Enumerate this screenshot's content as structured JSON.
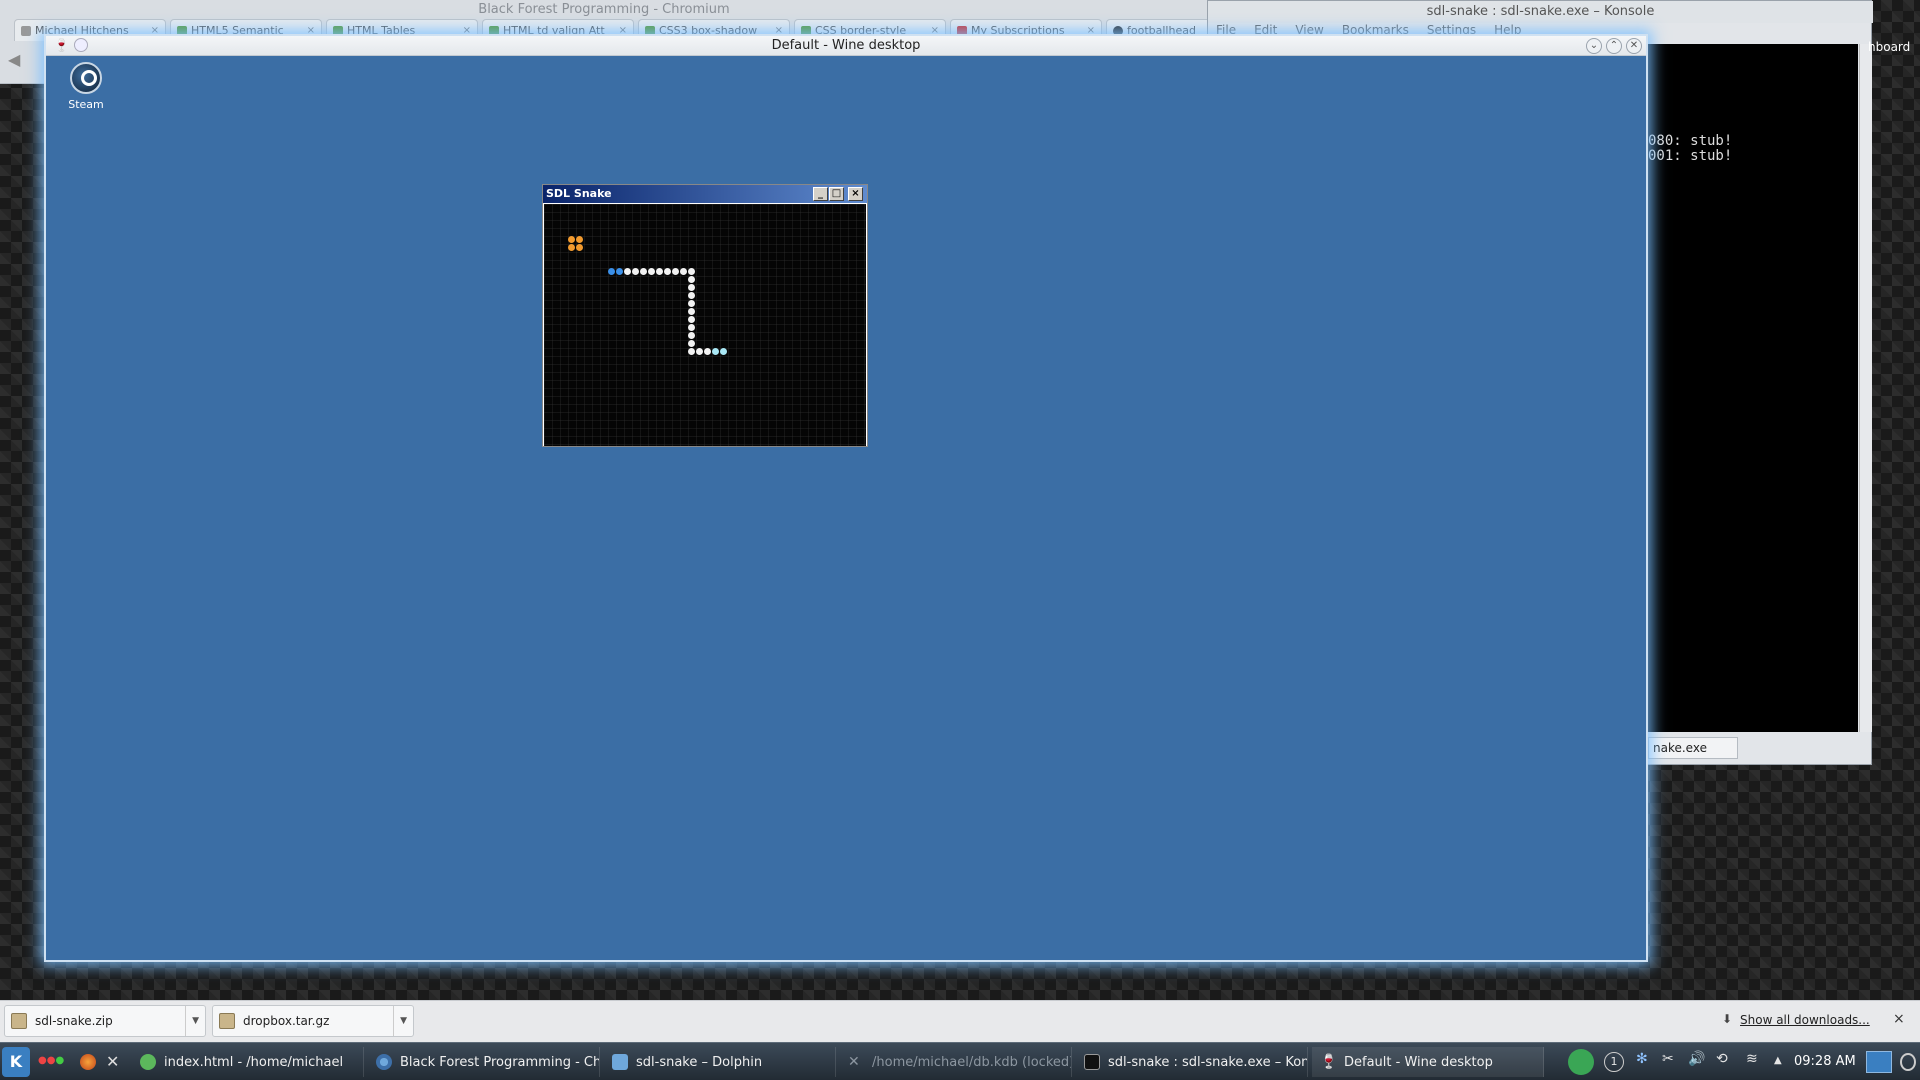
{
  "chromium": {
    "title": "Black Forest Programming - Chromium",
    "tabs": [
      "Michael Hitchens",
      "HTML5 Semantic",
      "HTML Tables",
      "HTML td valign Att",
      "CSS3 box-shadow",
      "CSS border-style",
      "My Subscriptions",
      "footballhead"
    ]
  },
  "konsole": {
    "title": "sdl-snake : sdl-snake.exe – Konsole",
    "menu": [
      "File",
      "Edit",
      "View",
      "Bookmarks",
      "Settings",
      "Help"
    ],
    "terminal_lines": [
      "080: stub!",
      "001: stub!"
    ],
    "tab_label": "nake.exe",
    "side_text": "hboard"
  },
  "wine": {
    "title": "Default - Wine desktop",
    "desktop_icon": "Steam"
  },
  "snake": {
    "title": "SDL Snake",
    "colors": {
      "food": "#f29a2e",
      "head": "#3a8fe8",
      "body": "#f2f2f2",
      "tail": "#a9e8f5",
      "board": "#050505"
    },
    "cols": 32,
    "rows": 25,
    "food": [
      [
        3,
        4
      ],
      [
        4,
        4
      ],
      [
        3,
        5
      ],
      [
        4,
        5
      ]
    ],
    "head": [
      [
        8,
        8
      ],
      [
        9,
        8
      ]
    ],
    "body": [
      [
        10,
        8
      ],
      [
        11,
        8
      ],
      [
        12,
        8
      ],
      [
        13,
        8
      ],
      [
        14,
        8
      ],
      [
        15,
        8
      ],
      [
        16,
        8
      ],
      [
        17,
        8
      ],
      [
        18,
        8
      ],
      [
        18,
        9
      ],
      [
        18,
        10
      ],
      [
        18,
        11
      ],
      [
        18,
        12
      ],
      [
        18,
        13
      ],
      [
        18,
        14
      ],
      [
        18,
        15
      ],
      [
        18,
        16
      ],
      [
        18,
        17
      ],
      [
        18,
        18
      ],
      [
        19,
        18
      ],
      [
        20,
        18
      ]
    ],
    "tail": [
      [
        21,
        18
      ],
      [
        22,
        18
      ]
    ]
  },
  "downloads": {
    "items": [
      "sdl-snake.zip",
      "dropbox.tar.gz"
    ],
    "show_all": "Show all downloads...",
    "close": "×"
  },
  "taskbar": {
    "tasks": [
      {
        "label": "index.html - /home/michael",
        "state": "normal"
      },
      {
        "label": "Black Forest Programming - Chrom",
        "state": "normal"
      },
      {
        "label": "sdl-snake – Dolphin",
        "state": "normal"
      },
      {
        "label": "/home/michael/db.kdb (locked) –",
        "state": "dim"
      },
      {
        "label": "sdl-snake : sdl-snake.exe – Konsol",
        "state": "normal"
      },
      {
        "label": "Default - Wine desktop",
        "state": "active"
      }
    ],
    "clock": "09:28 AM"
  }
}
